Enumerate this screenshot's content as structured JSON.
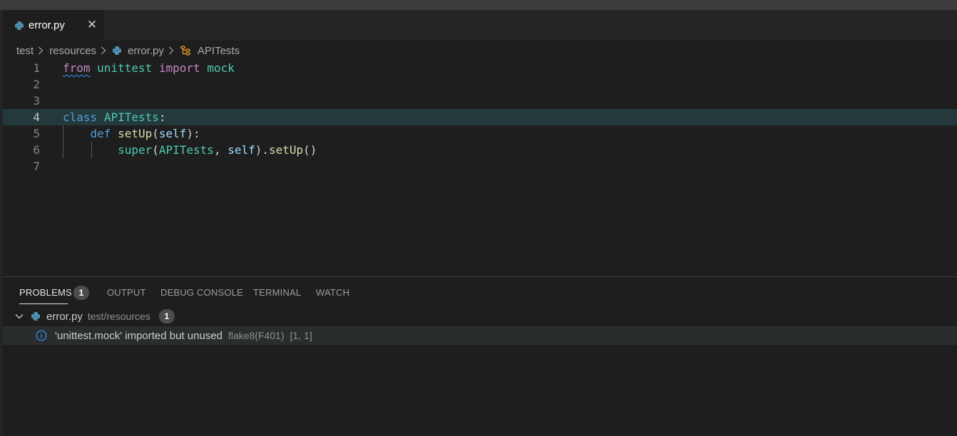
{
  "tab": {
    "filename": "error.py",
    "close_glyph": "✕"
  },
  "breadcrumb": [
    "test",
    "resources",
    "error.py",
    "APITests"
  ],
  "editor": {
    "lines": [
      {
        "num": "1",
        "tokens": [
          [
            "from",
            "kw squiggle"
          ],
          [
            " ",
            "txt"
          ],
          [
            "unittest",
            "mod"
          ],
          [
            " ",
            "txt"
          ],
          [
            "import",
            "kw"
          ],
          [
            " ",
            "txt"
          ],
          [
            "mock",
            "mod"
          ]
        ]
      },
      {
        "num": "2",
        "tokens": []
      },
      {
        "num": "3",
        "tokens": []
      },
      {
        "num": "4",
        "tokens": [
          [
            "class",
            "blue"
          ],
          [
            " ",
            "txt"
          ],
          [
            "APITests",
            "mod"
          ],
          [
            ":",
            "txt"
          ]
        ]
      },
      {
        "num": "5",
        "tokens": [
          [
            "    ",
            "txt"
          ],
          [
            "def",
            "blue"
          ],
          [
            " ",
            "txt"
          ],
          [
            "setUp",
            "fn"
          ],
          [
            "(",
            "txt"
          ],
          [
            "self",
            "param"
          ],
          [
            "):",
            "txt"
          ]
        ]
      },
      {
        "num": "6",
        "tokens": [
          [
            "        ",
            "txt"
          ],
          [
            "super",
            "mod"
          ],
          [
            "(",
            "txt"
          ],
          [
            "APITests",
            "mod"
          ],
          [
            ", ",
            "txt"
          ],
          [
            "self",
            "param"
          ],
          [
            ").",
            "txt"
          ],
          [
            "setUp",
            "fn"
          ],
          [
            "()",
            "txt"
          ]
        ]
      },
      {
        "num": "7",
        "tokens": []
      }
    ],
    "current_line": 4
  },
  "panel": {
    "tabs": [
      "PROBLEMS",
      "OUTPUT",
      "DEBUG CONSOLE",
      "TERMINAL",
      "WATCH"
    ],
    "problems_count": "1",
    "file": {
      "name": "error.py",
      "path": "test/resources",
      "count": "1"
    },
    "problem": {
      "message": "'unittest.mock' imported but unused",
      "source": "flake8(F401)",
      "position": "[1, 1]"
    }
  },
  "colors": {
    "accent": "#3794ff",
    "python_blue": "#519aba"
  }
}
